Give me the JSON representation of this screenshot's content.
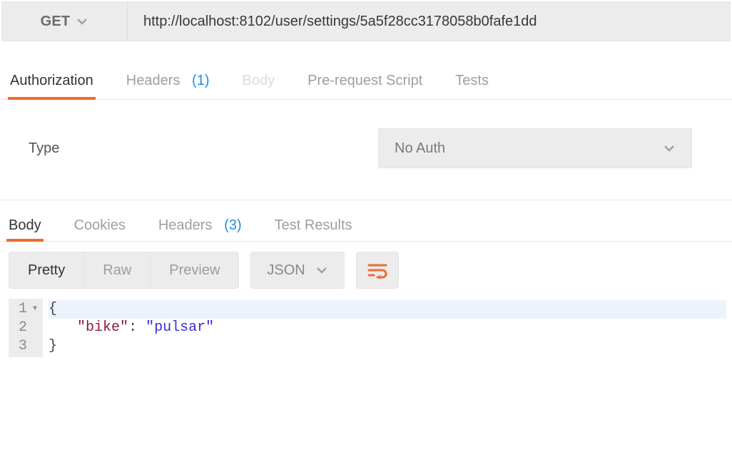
{
  "request": {
    "method": "GET",
    "url": "http://localhost:8102/user/settings/5a5f28cc3178058b0fafe1dd"
  },
  "request_tabs": [
    {
      "label": "Authorization",
      "active": true
    },
    {
      "label": "Headers",
      "count": "(1)"
    },
    {
      "label": "Body",
      "disabled": true
    },
    {
      "label": "Pre-request Script"
    },
    {
      "label": "Tests"
    }
  ],
  "auth": {
    "type_label": "Type",
    "selected": "No Auth"
  },
  "response_tabs": [
    {
      "label": "Body",
      "active": true
    },
    {
      "label": "Cookies"
    },
    {
      "label": "Headers",
      "count": "(3)"
    },
    {
      "label": "Test Results"
    }
  ],
  "view_modes": [
    {
      "label": "Pretty",
      "active": true
    },
    {
      "label": "Raw"
    },
    {
      "label": "Preview"
    }
  ],
  "format": {
    "selected": "JSON"
  },
  "code_lines": [
    "1",
    "2",
    "3"
  ],
  "body_json": {
    "key1": "bike",
    "val1": "pulsar"
  }
}
